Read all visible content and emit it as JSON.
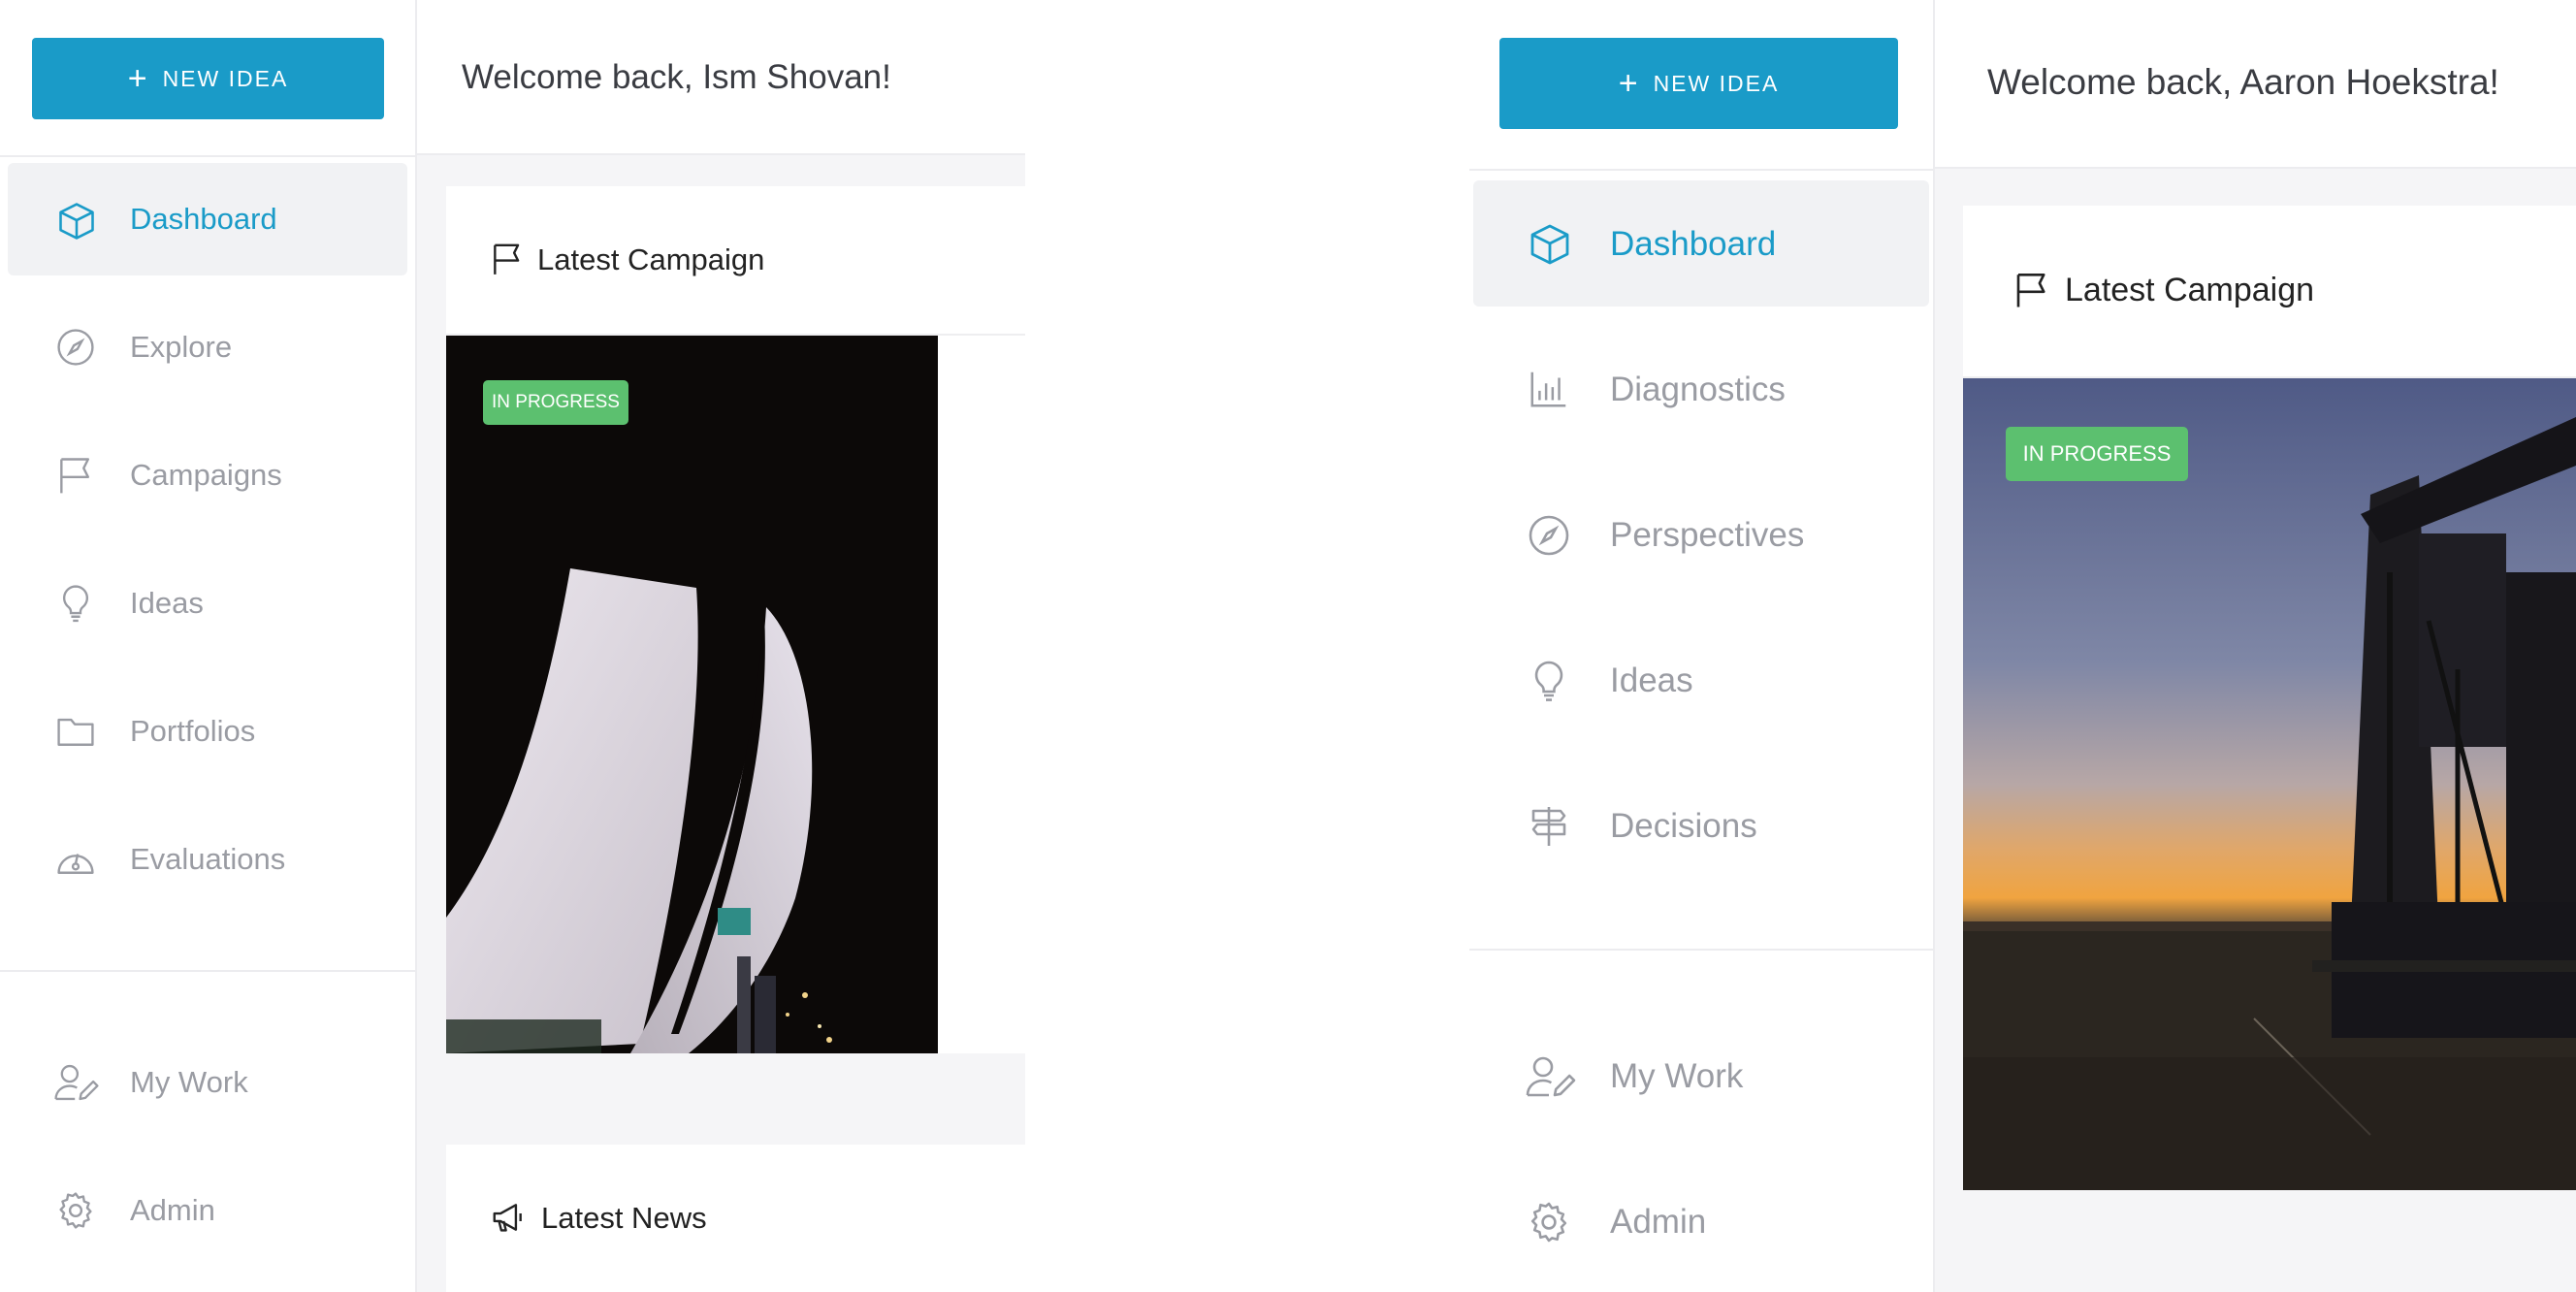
{
  "left": {
    "new_idea_label": "NEW IDEA",
    "welcome": "Welcome back, Ism Shovan!",
    "nav": [
      {
        "label": "Dashboard",
        "icon": "cube-icon",
        "active": true
      },
      {
        "label": "Explore",
        "icon": "compass-icon"
      },
      {
        "label": "Campaigns",
        "icon": "flag-icon"
      },
      {
        "label": "Ideas",
        "icon": "lightbulb-icon"
      },
      {
        "label": "Portfolios",
        "icon": "folder-icon"
      },
      {
        "label": "Evaluations",
        "icon": "gauge-icon"
      }
    ],
    "bottom_nav": [
      {
        "label": "My Work",
        "icon": "user-pen-icon"
      },
      {
        "label": "Admin",
        "icon": "gear-icon"
      }
    ],
    "latest_campaign": "Latest Campaign",
    "campaign_status": "IN PROGRESS",
    "latest_news": "Latest News"
  },
  "right": {
    "new_idea_label": "NEW IDEA",
    "welcome": "Welcome back, Aaron Hoekstra!",
    "nav": [
      {
        "label": "Dashboard",
        "icon": "cube-icon",
        "active": true
      },
      {
        "label": "Diagnostics",
        "icon": "bar-chart-icon"
      },
      {
        "label": "Perspectives",
        "icon": "compass-icon"
      },
      {
        "label": "Ideas",
        "icon": "lightbulb-icon"
      },
      {
        "label": "Decisions",
        "icon": "signpost-icon"
      }
    ],
    "bottom_nav": [
      {
        "label": "My Work",
        "icon": "user-pen-icon"
      },
      {
        "label": "Admin",
        "icon": "gear-icon"
      }
    ],
    "latest_campaign": "Latest Campaign",
    "campaign_status": "IN PROGRESS"
  },
  "colors": {
    "accent": "#1a9bc8",
    "status_green": "#5cc06f",
    "muted_text": "#9a9ca3"
  }
}
